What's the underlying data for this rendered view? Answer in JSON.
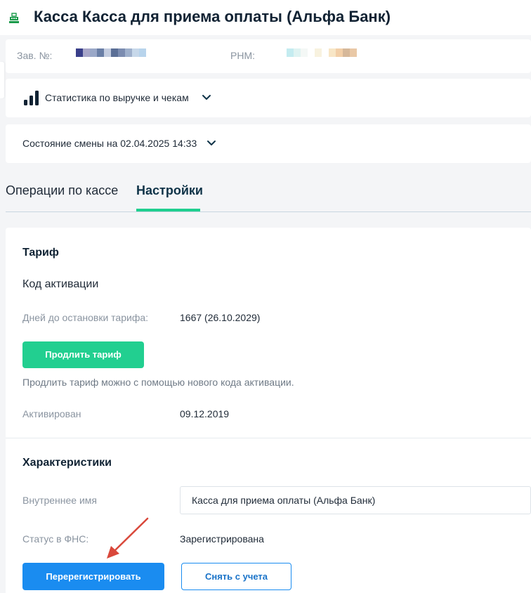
{
  "header": {
    "icon": "cash-register-icon",
    "title": "Касса Касса для приема оплаты (Альфа Банк)"
  },
  "registration": {
    "zav_label": "Зав. №:",
    "rnm_label": "РНМ:",
    "zav_blur_colors": [
      "#3a3f8a",
      "#a8a6c8",
      "#9aa8c8",
      "#6a7fa6",
      "#c4cde0",
      "#5b6f96",
      "#7b8cb0",
      "#9fb0cc",
      "#c7d8ea",
      "#b8d4ec"
    ],
    "rnm_blur_colors": [
      "#c4ecf0",
      "#dff3f2",
      "#f4f8f6",
      "#ffffff",
      "#f8f2df",
      "#ffffff",
      "#f8e6c6",
      "#f2cfa8",
      "#d6b89a",
      "#e9c8a6"
    ]
  },
  "stats": {
    "icon": "bar-chart-icon",
    "label": "Статистика по выручке и чекам"
  },
  "shift": {
    "label": "Состояние смены на 02.04.2025 14:33"
  },
  "tabs": [
    {
      "label": "Операции по кассе",
      "active": false
    },
    {
      "label": "Настройки",
      "active": true
    }
  ],
  "tariff": {
    "title": "Тариф",
    "subtitle": "Код активации",
    "days_label": "Дней до остановки тарифа:",
    "days_value": "1667 (26.10.2029)",
    "extend_button": "Продлить тариф",
    "hint": "Продлить тариф можно с помощью нового кода активации.",
    "activated_label": "Активирован",
    "activated_value": "09.12.2019"
  },
  "characteristics": {
    "title": "Характеристики",
    "internal_name_label": "Внутреннее имя",
    "internal_name_value": "Касса для приема оплаты (Альфа Банк)",
    "fns_status_label": "Статус в ФНС:",
    "fns_status_value": "Зарегистрирована",
    "reregister_button": "Перерегистрировать",
    "deregister_button": "Снять с учета"
  },
  "colors": {
    "accent_green": "#22cf90",
    "accent_blue": "#1a8cf0",
    "annotation_arrow": "#d9483b"
  }
}
